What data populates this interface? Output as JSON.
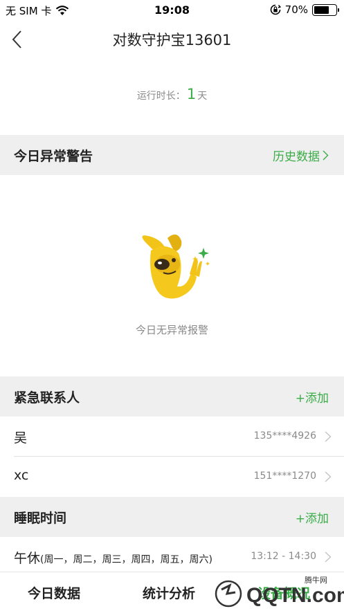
{
  "status_bar": {
    "carrier": "无 SIM 卡",
    "time": "19:08",
    "battery_percent": "70%",
    "battery_level": 0.7,
    "icons": [
      "wifi-icon",
      "orientation-lock-icon",
      "battery-icon"
    ]
  },
  "nav": {
    "title": "对数守护宝13601",
    "back_icon": "chevron-left-icon"
  },
  "runtime": {
    "label": "运行时长：",
    "value": "1",
    "unit": "天"
  },
  "alerts": {
    "title": "今日异常警告",
    "action": "历史数据",
    "empty_text": "今日无异常报警"
  },
  "contacts": {
    "title": "紧急联系人",
    "action": "+添加",
    "items": [
      {
        "name": "吴",
        "phone": "135****4926"
      },
      {
        "name": "xc",
        "phone": "151****1270"
      }
    ]
  },
  "sleep": {
    "title": "睡眠时间",
    "action": "+添加",
    "items": [
      {
        "name": "午休",
        "days": "(周一，周二，周三，周四，周五，周六)",
        "time": "13:12 - 14:30"
      }
    ]
  },
  "tabs": [
    {
      "label": "今日数据"
    },
    {
      "label": "统计分析"
    },
    {
      "label": "设备概况"
    }
  ],
  "watermark": {
    "text": "QQTN.com",
    "subtext": "腾牛网"
  },
  "colors": {
    "accent": "#3aac48",
    "section_bg": "#efefef",
    "muted": "#8a8a8a"
  }
}
